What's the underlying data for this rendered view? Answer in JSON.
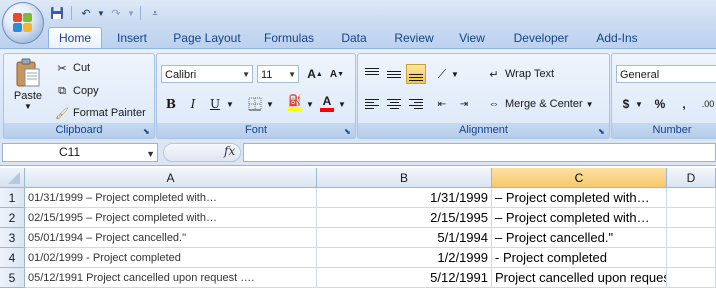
{
  "qat": {
    "save_icon": "save-icon",
    "undo_icon": "undo-icon",
    "redo_icon": "redo-icon"
  },
  "tabs": [
    "Home",
    "Insert",
    "Page Layout",
    "Formulas",
    "Data",
    "Review",
    "View",
    "Developer",
    "Add-Ins"
  ],
  "clipboard": {
    "paste": "Paste",
    "cut": "Cut",
    "copy": "Copy",
    "format_painter": "Format Painter",
    "label": "Clipboard"
  },
  "font": {
    "name": "Calibri",
    "size": "11",
    "bold": "B",
    "italic": "I",
    "underline": "U",
    "label": "Font",
    "fill_color": "#ffff00",
    "font_color": "#ff0000"
  },
  "alignment": {
    "wrap_text": "Wrap Text",
    "merge_center": "Merge & Center",
    "label": "Alignment"
  },
  "number": {
    "format": "General",
    "currency": "$",
    "percent": "%",
    "comma": ",",
    "increase_decimal": ".00",
    "label": "Number"
  },
  "formula_bar": {
    "name_box": "C11",
    "fx": "fx",
    "value": ""
  },
  "columns": [
    "A",
    "B",
    "C",
    "D"
  ],
  "rows": [
    {
      "num": "1",
      "a": "01/31/1999  – Project completed with…",
      "b": "1/31/1999",
      "c": " – Project completed with…"
    },
    {
      "num": "2",
      "a": " 02/15/1995 – Project completed with…",
      "b": "2/15/1995",
      "c": " – Project completed with…"
    },
    {
      "num": "3",
      "a": "05/01/1994  – Project cancelled.\"",
      "b": "5/1/1994",
      "c": " – Project cancelled.\""
    },
    {
      "num": "4",
      "a": "01/02/1999 - Project completed",
      "b": "1/2/1999",
      "c": " - Project completed"
    },
    {
      "num": "5",
      "a": "05/12/1991 Project cancelled upon request ….",
      "b": "5/12/1991",
      "c": " Project cancelled upon request …."
    }
  ]
}
